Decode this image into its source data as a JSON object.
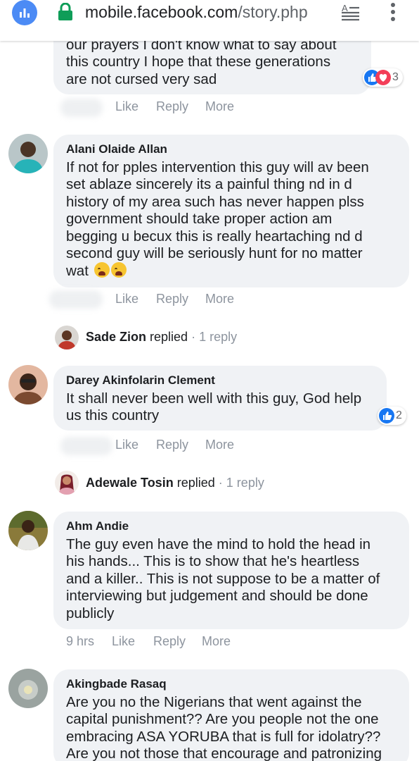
{
  "browser": {
    "url_host": "mobile.facebook.com",
    "url_path": "/story.php",
    "icons": [
      "analytics-icon",
      "lock-icon",
      "reader-mode-icon",
      "more-vert-icon"
    ]
  },
  "colors": {
    "bubble": "#f0f2f5",
    "like_blue": "#1877f2",
    "love_red": "#f33e58",
    "meta_gray": "#8d949e"
  },
  "comments": [
    {
      "text_lines": [
        "our prayers I don't know what to say about",
        "this country I hope that these generations",
        "are not cursed very sad"
      ],
      "actions": {
        "like": "Like",
        "reply": "Reply",
        "more": "More"
      },
      "reactions": {
        "count": "3",
        "types": [
          "like",
          "love"
        ]
      }
    },
    {
      "author": "Alani Olaide Allan",
      "text_lines": [
        "If not for pples intervention this guy will av been",
        "set ablaze sincerely its a painful thing nd in d",
        "history of my area such has never happen plss",
        "government should take proper action am",
        "begging u becux this is really heartaching nd d",
        "second guy will be seriously hunt for no matter",
        "wat"
      ],
      "emojis": [
        "crying-face-icon",
        "crying-face-icon"
      ],
      "actions": {
        "like": "Like",
        "reply": "Reply",
        "more": "More"
      },
      "replies": {
        "name": "Sade Zion",
        "verb": "replied",
        "sep": "·",
        "count": "1 reply"
      }
    },
    {
      "author": "Darey Akinfolarin Clement",
      "text_lines": [
        "It shall never been well with this guy, God help",
        "us this country"
      ],
      "actions": {
        "like": "Like",
        "reply": "Reply",
        "more": "More"
      },
      "reactions": {
        "count": "2",
        "types": [
          "like"
        ]
      },
      "replies": {
        "name": "Adewale Tosin",
        "verb": "replied",
        "sep": "·",
        "count": "1 reply"
      }
    },
    {
      "author": "Ahm Andie",
      "text_lines": [
        "The guy even have the mind to hold the head in",
        "his hands... This is to show that he's heartless",
        "and a killer.. This is not suppose to be a matter of",
        "interviewing but judgement and should be done",
        "publicly"
      ],
      "actions": {
        "time": "9 hrs",
        "like": "Like",
        "reply": "Reply",
        "more": "More"
      }
    },
    {
      "author": "Akingbade Rasaq",
      "text_lines": [
        "Are you no the Nigerians that went against the",
        "capital punishment?? Are you people not the one",
        "embracing ASA YORUBA that is full for idolatry??",
        "Are you not those that encourage and patronizing"
      ]
    }
  ]
}
